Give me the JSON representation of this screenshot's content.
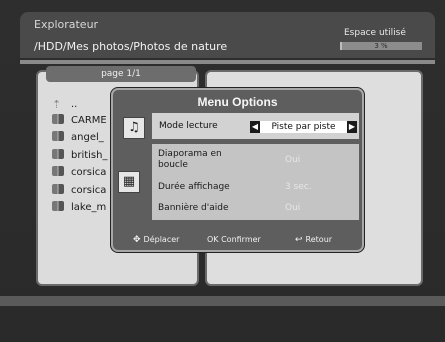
{
  "header": {
    "title": "Explorateur",
    "path": "/HDD/Mes photos/Photos de nature",
    "space_label": "Espace utilisé",
    "space_value": "3 %",
    "space_fraction": 0.03
  },
  "file_list": {
    "page_label": "page 1/1",
    "items": [
      {
        "label": "..",
        "icon": "up-arrow-icon"
      },
      {
        "label": "CARME",
        "icon": "photo-folder-icon"
      },
      {
        "label": "angel_",
        "icon": "photo-folder-icon"
      },
      {
        "label": "british_",
        "icon": "photo-folder-icon"
      },
      {
        "label": "corsica",
        "icon": "photo-folder-icon"
      },
      {
        "label": "corsica",
        "icon": "photo-folder-icon"
      },
      {
        "label": "lake_m",
        "icon": "photo-folder-icon"
      }
    ]
  },
  "menu": {
    "title": "Menu Options",
    "mode_label": "Mode lecture",
    "mode_value": "Piste par piste",
    "options": [
      {
        "label": "Diaporama en boucle",
        "value": "Oui"
      },
      {
        "label": "Durée affichage",
        "value": "3 sec."
      },
      {
        "label": "Bannière d'aide",
        "value": "Oui"
      }
    ],
    "help": {
      "move": "Déplacer",
      "ok_key": "OK",
      "confirm": "Confirmer",
      "back": "Retour"
    }
  }
}
